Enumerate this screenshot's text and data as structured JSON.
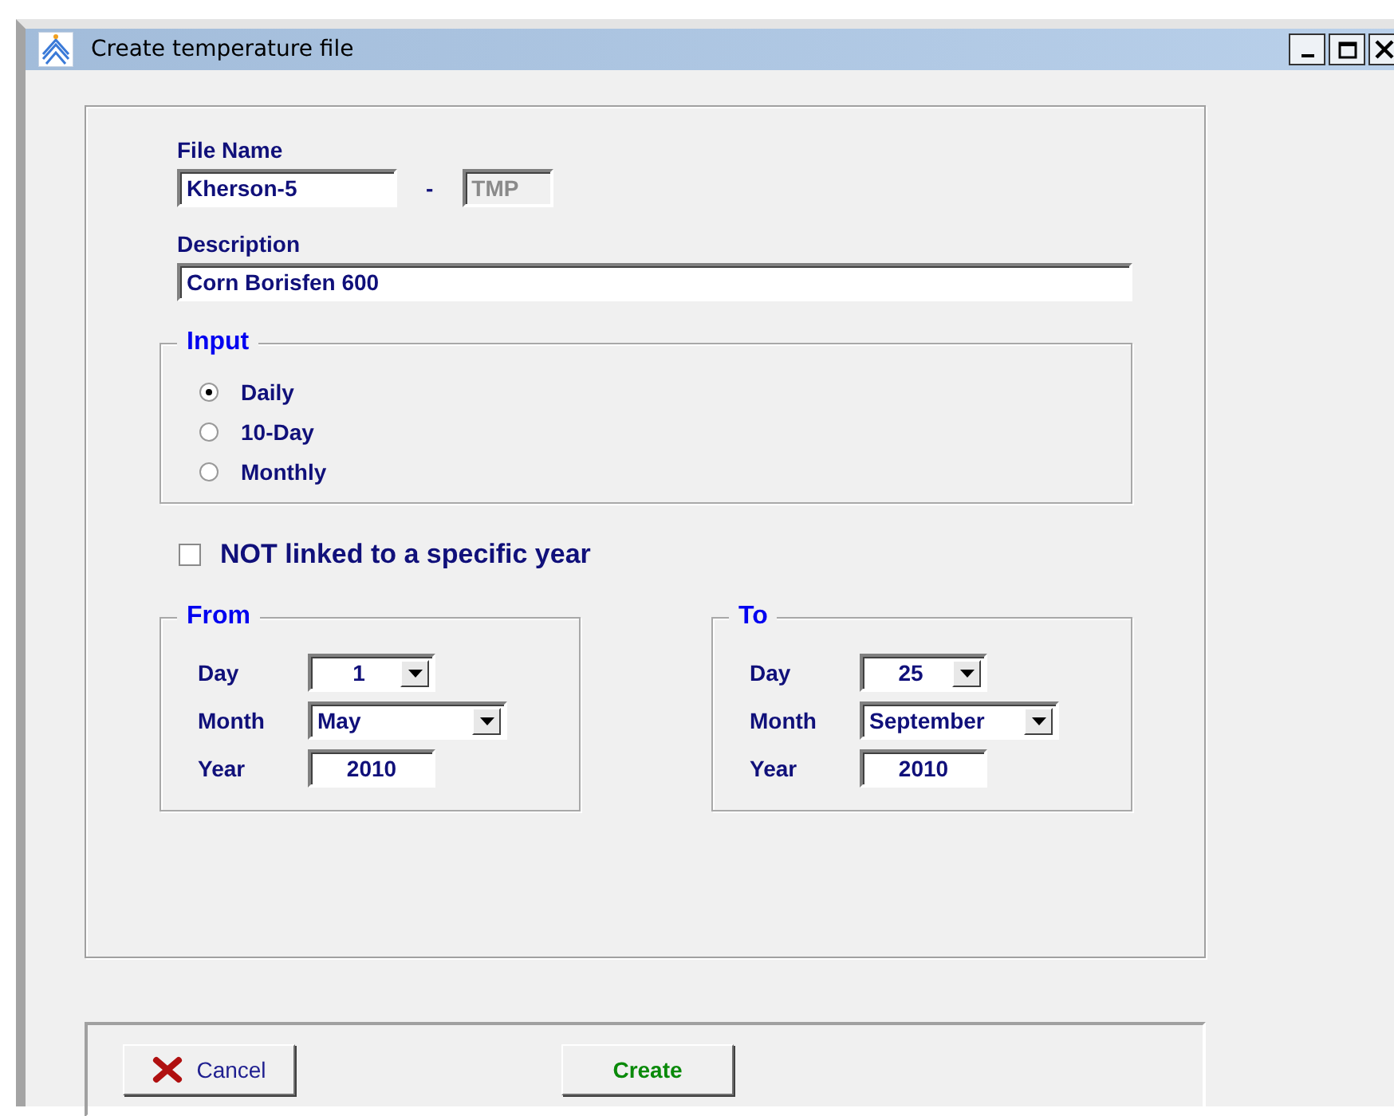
{
  "window": {
    "title": "Create temperature file"
  },
  "file_name": {
    "label": "File Name",
    "value": "Kherson-5",
    "separator": "-",
    "extension": {
      "value": "TMP",
      "disabled": true
    }
  },
  "description": {
    "label": "Description",
    "value": "Corn Borisfen 600"
  },
  "input": {
    "title": "Input",
    "options": [
      {
        "label": "Daily",
        "selected": true
      },
      {
        "label": "10-Day",
        "selected": false
      },
      {
        "label": "Monthly",
        "selected": false
      }
    ]
  },
  "not_linked": {
    "label": "NOT linked to a specific year",
    "checked": false
  },
  "periods": [
    {
      "title": "From",
      "fields": [
        {
          "kind": "day",
          "label": "Day",
          "value": "1"
        },
        {
          "kind": "month",
          "label": "Month",
          "value": "May"
        },
        {
          "kind": "year",
          "label": "Year",
          "value": "2010"
        }
      ]
    },
    {
      "title": "To",
      "fields": [
        {
          "kind": "day",
          "label": "Day",
          "value": "25"
        },
        {
          "kind": "month",
          "label": "Month",
          "value": "September"
        },
        {
          "kind": "year",
          "label": "Year",
          "value": "2010"
        }
      ]
    }
  ],
  "buttons": [
    {
      "kind": "cancel",
      "label": "Cancel"
    },
    {
      "kind": "create",
      "label": "Create"
    }
  ]
}
